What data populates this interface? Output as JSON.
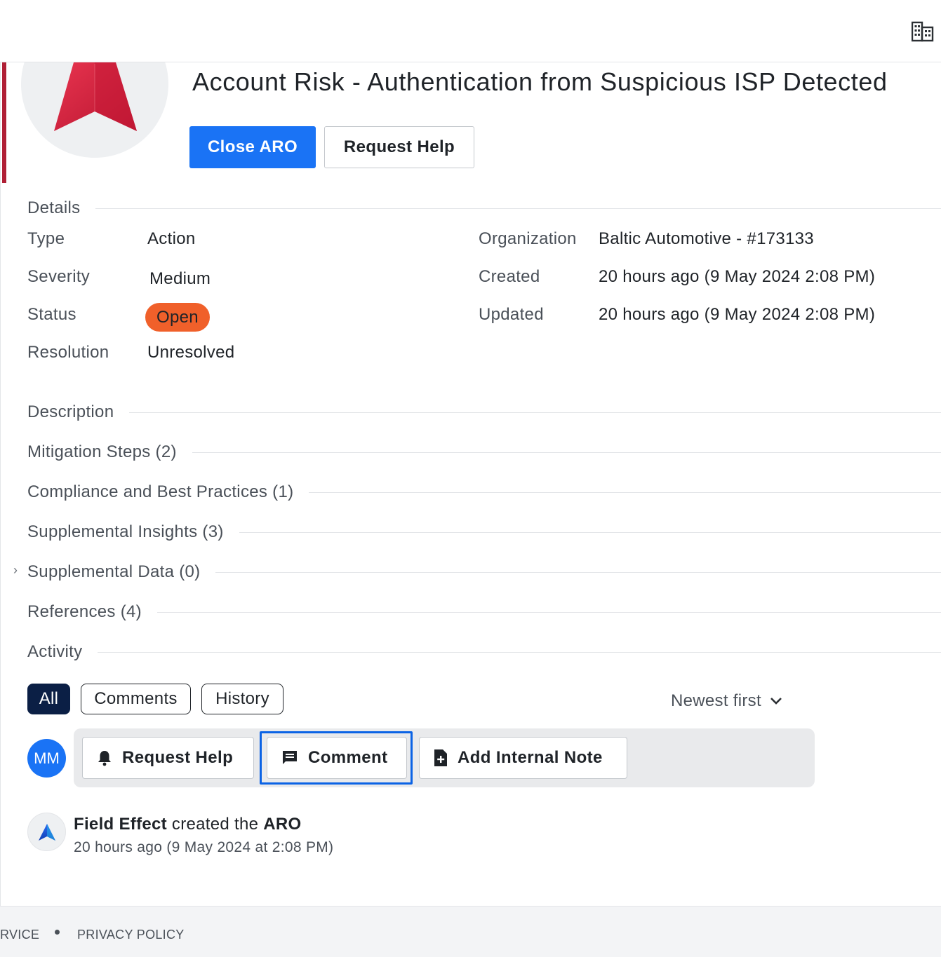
{
  "header": {
    "org_icon": "building-icon"
  },
  "aro": {
    "title": "Account Risk - Authentication from Suspicious ISP Detected",
    "close_label": "Close ARO",
    "request_help_label": "Request Help",
    "logo_icon": "field-effect-logo-icon",
    "accent_color": "#b01f35"
  },
  "details": {
    "heading": "Details",
    "left": [
      {
        "label": "Type",
        "value": "Action"
      },
      {
        "label": "Severity",
        "value": "Medium"
      },
      {
        "label": "Status",
        "value": "Open"
      },
      {
        "label": "Resolution",
        "value": "Unresolved"
      }
    ],
    "right": [
      {
        "label": "Organization",
        "value": "Baltic Automotive - #173133"
      },
      {
        "label": "Created",
        "value": "20 hours ago (9 May 2024 2:08 PM)"
      },
      {
        "label": "Updated",
        "value": "20 hours ago (9 May 2024 2:08 PM)"
      }
    ],
    "status_color": "#f0602a"
  },
  "sections": [
    {
      "label": "Description"
    },
    {
      "label": "Mitigation Steps (2)"
    },
    {
      "label": "Compliance and Best Practices (1)"
    },
    {
      "label": "Supplemental Insights (3)"
    },
    {
      "label": "Supplemental Data (0)"
    },
    {
      "label": "References (4)"
    },
    {
      "label": "Activity"
    }
  ],
  "activity": {
    "filters": [
      {
        "label": "All"
      },
      {
        "label": "Comments"
      },
      {
        "label": "History"
      }
    ],
    "sort_label": "Newest first",
    "user_initials": "MM",
    "actions": [
      {
        "label": "Request Help",
        "icon": "bell-icon"
      },
      {
        "label": "Comment",
        "icon": "comment-icon"
      },
      {
        "label": "Add Internal Note",
        "icon": "note-add-icon"
      }
    ],
    "feed": [
      {
        "actor": "Field Effect",
        "verb": "created the",
        "object": "ARO",
        "time": "20 hours ago (9 May 2024 at 2:08 PM)"
      }
    ]
  },
  "footer": {
    "links": [
      {
        "label": "RVICE"
      },
      {
        "label": "PRIVACY POLICY"
      }
    ]
  }
}
